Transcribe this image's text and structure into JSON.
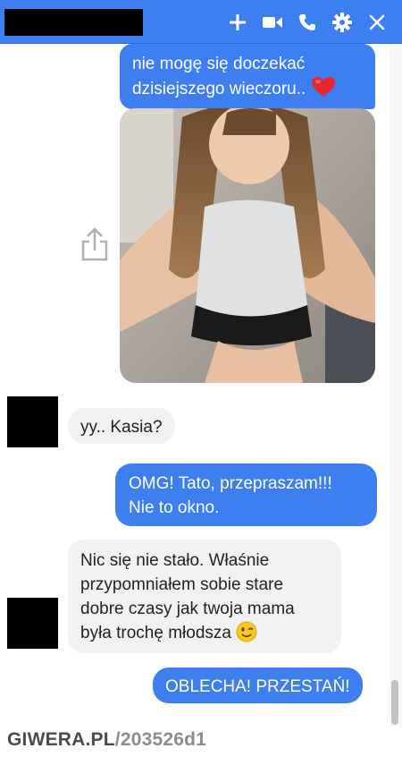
{
  "header": {
    "icons": [
      "plus-icon",
      "video-camera-icon",
      "phone-icon",
      "gear-icon",
      "close-icon"
    ],
    "color": "#3d7ef0"
  },
  "messages": [
    {
      "from": "me",
      "line1": "nie mogę się doczekać",
      "line2": "dzisiejszego wieczoru..",
      "emoji": "heart-icon"
    },
    {
      "from": "me",
      "type": "photo"
    },
    {
      "from": "them",
      "text": "yy.. Kasia?"
    },
    {
      "from": "me",
      "line1": "OMG! Tato, przepraszam!!!",
      "line2": "Nie to okno."
    },
    {
      "from": "them",
      "line1": "Nic się nie stało. Właśnie",
      "line2": "przypomniałem sobie stare",
      "line3": "dobre czasy jak twoja mama",
      "line4": "była trochę młodsza",
      "emoji": "wink-emoji-icon"
    },
    {
      "from": "me",
      "text": "OBLECHA! PRZESTAŃ!"
    }
  ],
  "watermark": {
    "site": "GIWERA.PL",
    "id": "/203526d1"
  },
  "colors": {
    "outgoing": "#3d7ef0",
    "incoming": "#f1f1f1"
  }
}
